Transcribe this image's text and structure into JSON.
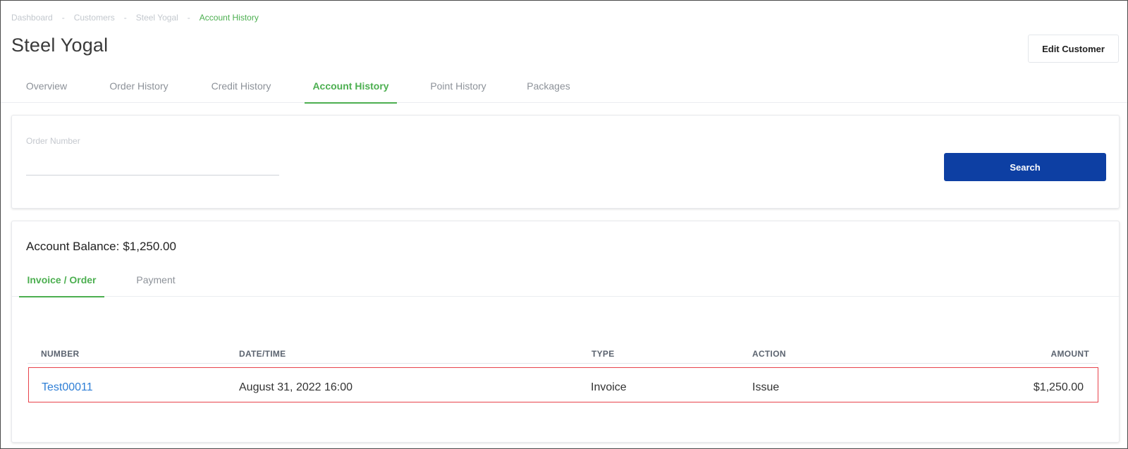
{
  "breadcrumb": [
    {
      "label": "Dashboard"
    },
    {
      "label": "Customers"
    },
    {
      "label": "Steel Yogal"
    },
    {
      "label": "Account History"
    }
  ],
  "breadcrumb_separator": "-",
  "page_title": "Steel Yogal",
  "edit_button_label": "Edit Customer",
  "main_tabs": [
    "Overview",
    "Order History",
    "Credit History",
    "Account History",
    "Point History",
    "Packages"
  ],
  "main_tab_active": "Account History",
  "search": {
    "label": "Order Number",
    "value": "",
    "placeholder": "",
    "button_label": "Search"
  },
  "account": {
    "balance_label": "Account Balance:",
    "balance_value": "$1,250.00"
  },
  "sub_tabs": [
    "Invoice / Order",
    "Payment"
  ],
  "sub_tab_active": "Invoice / Order",
  "table": {
    "columns": [
      "NUMBER",
      "DATE/TIME",
      "TYPE",
      "ACTION",
      "AMOUNT"
    ],
    "rows": [
      {
        "number": "Test00011",
        "datetime": "August 31, 2022 16:00",
        "type": "Invoice",
        "action": "Issue",
        "amount": "$1,250.00"
      }
    ]
  },
  "colors": {
    "accent_green": "#4caf50",
    "primary_blue": "#0d3fa3",
    "link_blue": "#2f7fd6",
    "highlight_red": "#e8434b"
  }
}
